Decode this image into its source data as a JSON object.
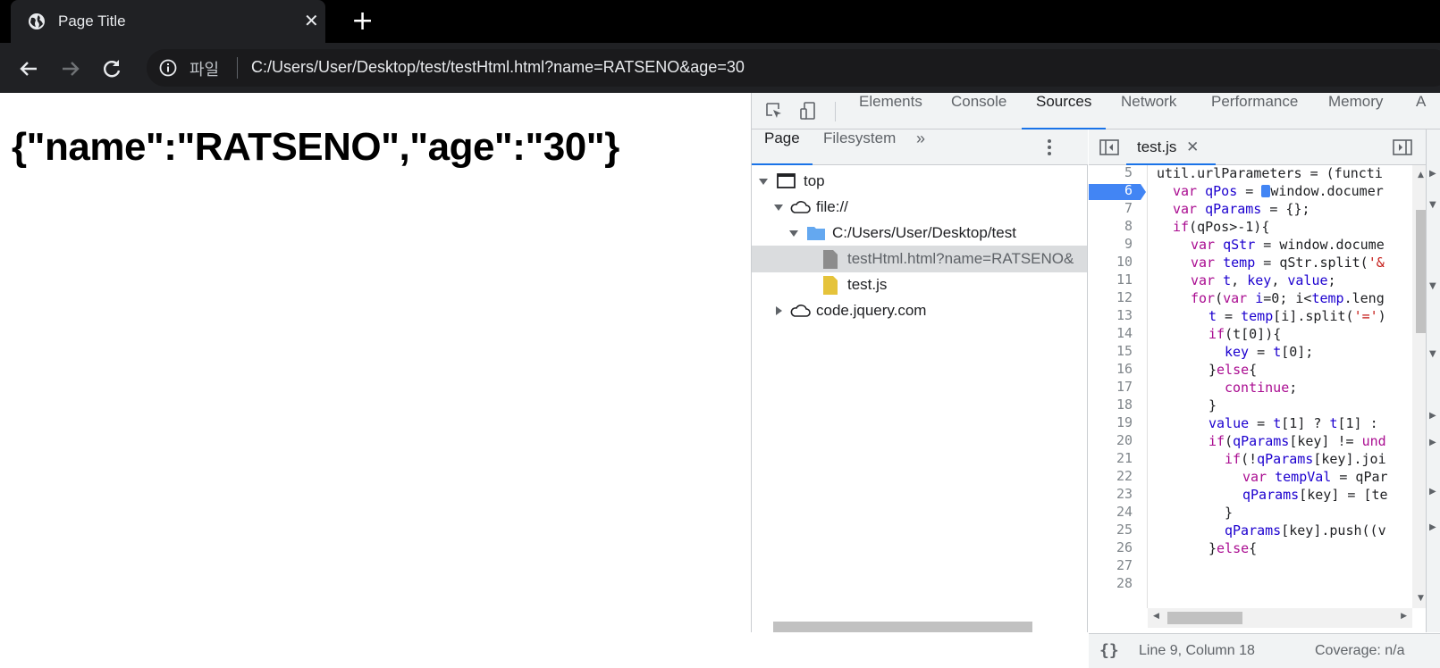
{
  "browser": {
    "tab_title": "Page Title",
    "address_prefix": "파일",
    "url": "C:/Users/User/Desktop/test/testHtml.html?name=RATSENO&age=30"
  },
  "page": {
    "content": "{\"name\":\"RATSENO\",\"age\":\"30\"}"
  },
  "devtools": {
    "tabs": [
      "Elements",
      "Console",
      "Sources",
      "Network",
      "Performance",
      "Memory",
      "A"
    ],
    "active_tab": "Sources",
    "navigator": {
      "tabs": [
        "Page",
        "Filesystem"
      ],
      "active": "Page",
      "tree": [
        {
          "label": "top",
          "type": "frame"
        },
        {
          "label": "file://",
          "type": "cloud"
        },
        {
          "label": "C:/Users/User/Desktop/test",
          "type": "folder"
        },
        {
          "label": "testHtml.html?name=RATSENO&",
          "type": "file-html"
        },
        {
          "label": "test.js",
          "type": "file-js"
        },
        {
          "label": "code.jquery.com",
          "type": "cloud"
        }
      ]
    },
    "editor": {
      "open_file": "test.js",
      "breakpoint_line": 6,
      "lines": [
        5,
        6,
        7,
        8,
        9,
        10,
        11,
        12,
        13,
        14,
        15,
        16,
        17,
        18,
        19,
        20,
        21,
        22,
        23,
        24,
        25,
        26,
        27,
        28
      ],
      "status_position": "Line 9, Column 18",
      "status_coverage": "Coverage: n/a",
      "format_icon": "{}"
    },
    "colors": {
      "accent": "#1a73e8",
      "keyword": "#aa0d91"
    }
  }
}
